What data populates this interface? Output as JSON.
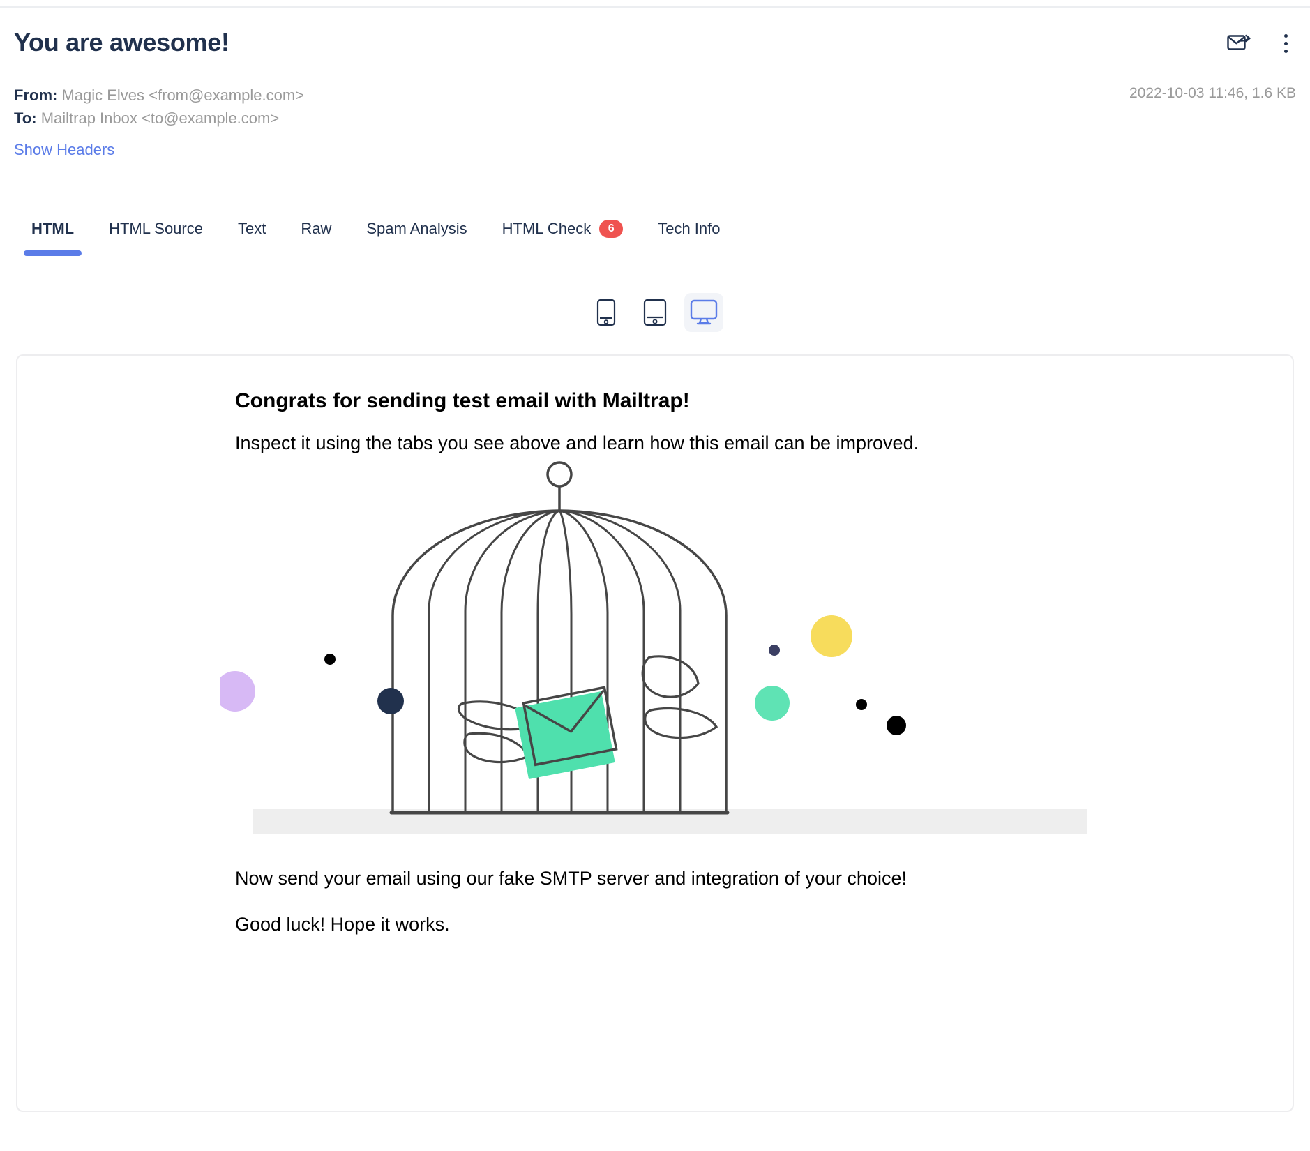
{
  "header": {
    "subject": "You are awesome!",
    "forward_icon": "envelope-forward-icon",
    "menu_icon": "kebab-menu-icon",
    "timestamp": "2022-10-03 11:46, 1.6 KB",
    "from_label": "From:",
    "from_value": "Magic Elves <from@example.com>",
    "to_label": "To:",
    "to_value": "Mailtrap Inbox <to@example.com>",
    "show_headers": "Show Headers"
  },
  "tabs": [
    {
      "label": "HTML",
      "active": true,
      "badge": null
    },
    {
      "label": "HTML Source",
      "active": false,
      "badge": null
    },
    {
      "label": "Text",
      "active": false,
      "badge": null
    },
    {
      "label": "Raw",
      "active": false,
      "badge": null
    },
    {
      "label": "Spam Analysis",
      "active": false,
      "badge": null
    },
    {
      "label": "HTML Check",
      "active": false,
      "badge": "6"
    },
    {
      "label": "Tech Info",
      "active": false,
      "badge": null
    }
  ],
  "devices": [
    {
      "name": "mobile-icon",
      "active": false
    },
    {
      "name": "tablet-icon",
      "active": false
    },
    {
      "name": "desktop-icon",
      "active": true
    }
  ],
  "email": {
    "heading": "Congrats for sending test email with Mailtrap!",
    "paragraph1": "Inspect it using the tabs you see above and learn how this email can be improved.",
    "paragraph2": "Now send your email using our fake SMTP server and integration of your choice!",
    "paragraph3": "Good luck! Hope it works.",
    "illustration": "birdcage-with-winged-envelope-illustration"
  },
  "colors": {
    "accent_blue": "#5b7ce8",
    "heading_navy": "#21314d",
    "muted_gray": "#9a9a9a",
    "badge_red": "#ef5350",
    "card_border": "#ededef",
    "cage_stroke": "#464646",
    "envelope_green": "#4fe0ad",
    "dot_purple": "#d7b9f5",
    "dot_navy": "#21314d",
    "dot_yellow": "#f7dc5c",
    "dot_mint": "#5fe3b4",
    "dot_black": "#000000",
    "floor_gray": "#eeeeee"
  }
}
